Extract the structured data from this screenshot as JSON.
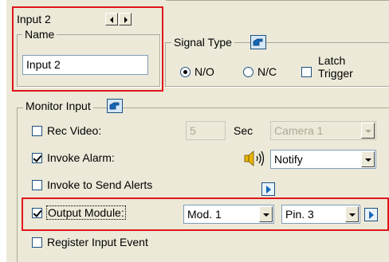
{
  "input_header": {
    "title": "Input 2"
  },
  "name_group": {
    "legend": "Name",
    "value": "Input 2"
  },
  "signal_type": {
    "legend": "Signal Type",
    "option_no": "N/O",
    "option_nc": "N/C",
    "latch_line1": "Latch",
    "latch_line2": "Trigger",
    "selected": "N/O"
  },
  "monitor_input": {
    "legend": "Monitor Input",
    "rec_video": {
      "label": "Rec Video:",
      "checked": false,
      "seconds": "5",
      "sec_label": "Sec",
      "camera": "Camera 1"
    },
    "invoke_alarm": {
      "label": "Invoke Alarm:",
      "checked": true,
      "sound": "Notify"
    },
    "send_alerts": {
      "label": "Invoke to Send Alerts",
      "checked": false
    },
    "output_module": {
      "label": "Output Module:",
      "checked": true,
      "module": "Mod. 1",
      "pin": "Pin. 3"
    },
    "register_event": {
      "label": "Register Input Event",
      "checked": false
    }
  },
  "colors": {
    "highlight": "#e0141b",
    "panel": "#ece9d8",
    "field_border": "#7f9db9"
  }
}
